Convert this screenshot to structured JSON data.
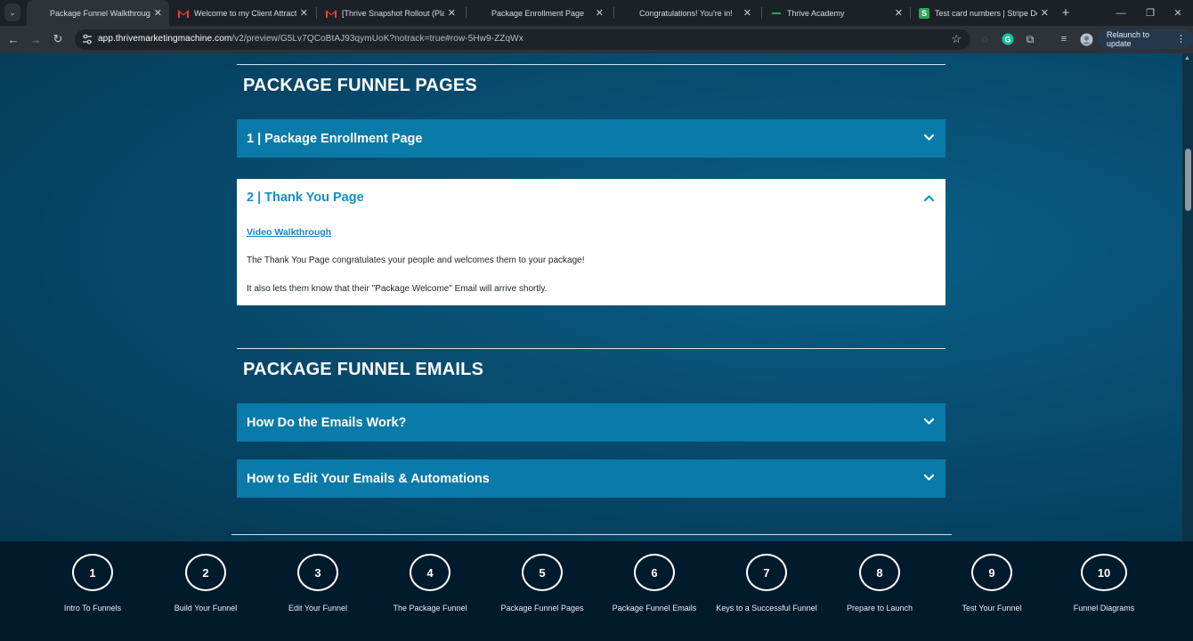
{
  "browser": {
    "tabs": [
      {
        "title": "Package Funnel Walkthrough (S",
        "icon": "video-favicon",
        "active": true
      },
      {
        "title": "Welcome to my Client Attractio",
        "icon": "gmail-icon",
        "active": false
      },
      {
        "title": "[Thrive Snapshot Rollout (Platin",
        "icon": "gmail-icon",
        "active": false
      },
      {
        "title": "Package Enrollment Page",
        "icon": "",
        "active": false
      },
      {
        "title": "Congratulations! You're in!",
        "icon": "",
        "active": false
      },
      {
        "title": "Thrive Academy",
        "icon": "thrive-icon",
        "active": false
      },
      {
        "title": "Test card numbers | Stripe Doc",
        "icon": "stripe-icon",
        "active": false
      }
    ],
    "new_tab": "+",
    "url_host": "app.thrivemarketingmachine.com",
    "url_path": "/v2/preview/G5Lv7QCoBtAJ93qymUoK?notrack=true#row-5Hw9-ZZqWx",
    "relaunch_label": "Relaunch to update"
  },
  "page": {
    "pages_section_title": "PACKAGE FUNNEL PAGES",
    "pages_accordions": [
      {
        "title": "1 | Package Enrollment Page",
        "open": false
      },
      {
        "title": "2 | Thank You Page",
        "open": true,
        "link": "Video Walkthrough",
        "paragraphs": [
          "The Thank You Page congratulates your people and welcomes them to your package!",
          "It also lets them know that their \"Package Welcome\" Email will arrive shortly."
        ]
      }
    ],
    "emails_section_title": "PACKAGE FUNNEL EMAILS",
    "emails_accordions": [
      {
        "title": "How Do the Emails Work?",
        "open": false
      },
      {
        "title": "How to Edit Your Emails & Automations",
        "open": false
      }
    ]
  },
  "steps": [
    {
      "number": "1",
      "label": "Intro To Funnels"
    },
    {
      "number": "2",
      "label": "Build Your Funnel"
    },
    {
      "number": "3",
      "label": "Edit Your Funnel"
    },
    {
      "number": "4",
      "label": "The Package Funnel"
    },
    {
      "number": "5",
      "label": "Package Funnel Pages"
    },
    {
      "number": "6",
      "label": "Package Funnel Emails"
    },
    {
      "number": "7",
      "label": "Keys to a Successful Funnel"
    },
    {
      "number": "8",
      "label": "Prepare to Launch"
    },
    {
      "number": "9",
      "label": "Test Your Funnel"
    },
    {
      "number": "10",
      "label": "Funnel Diagrams"
    }
  ],
  "colors": {
    "accordion": "#0a7aa9",
    "accordion_open_title": "#1290c8",
    "page_bg": "#07486a",
    "nav_bg": "#011a2c"
  }
}
